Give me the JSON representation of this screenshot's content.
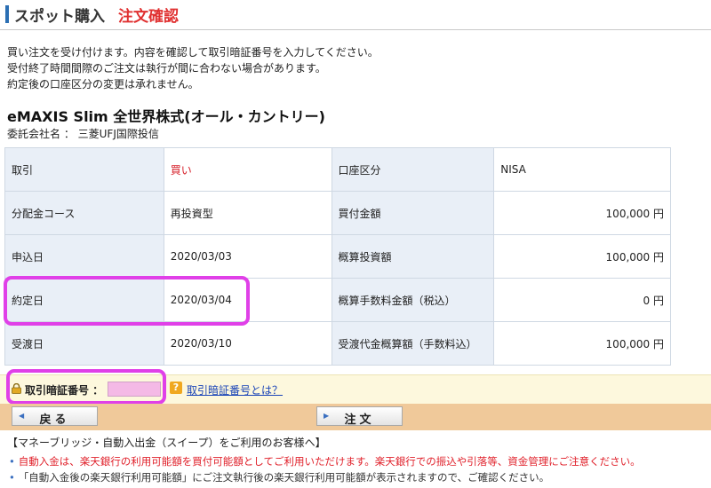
{
  "header": {
    "title": "スポット購入",
    "subtitle": "注文確認"
  },
  "intro": [
    "買い注文を受け付けます。内容を確認して取引暗証番号を入力してください。",
    "受付終了時間間際のご注文は執行が間に合わない場合があります。",
    "約定後の口座区分の変更は承れません。"
  ],
  "fund": {
    "name": "eMAXIS Slim 全世界株式(オール・カントリー)",
    "company_label": "委託会社名 ： 三菱UFJ国際投信"
  },
  "details": {
    "rows": [
      {
        "l1": "取引",
        "v1": "買い",
        "l2": "口座区分",
        "v2": "NISA"
      },
      {
        "l1": "分配金コース",
        "v1": "再投資型",
        "l2": "買付金額",
        "v2": "100,000 円"
      },
      {
        "l1": "申込日",
        "v1": "2020/03/03",
        "l2": "概算投資額",
        "v2": "100,000 円"
      },
      {
        "l1": "約定日",
        "v1": "2020/03/04",
        "l2": "概算手数料金額（税込）",
        "v2": "0 円"
      },
      {
        "l1": "受渡日",
        "v1": "2020/03/10",
        "l2": "受渡代金概算額（手数料込）",
        "v2": "100,000 円"
      }
    ]
  },
  "pin": {
    "label": "取引暗証番号 ：",
    "value": "",
    "help_icon": "question-icon",
    "help_link": "取引暗証番号とは？"
  },
  "buttons": {
    "back": "戻る",
    "order": "注文"
  },
  "sweep": {
    "title": "【マネーブリッジ・自動入出金（スイープ）をご利用のお客様へ】",
    "notes": [
      "自動入金は、楽天銀行の利用可能額を買付可能額としてご利用いただけます。楽天銀行での振込や引落等、資金管理にご注意ください。",
      "「自動入金後の楽天銀行利用可能額」にご注文執行後の楽天銀行利用可能額が表示されますので、ご確認ください。"
    ]
  },
  "colors": {
    "accent_red": "#d6202a",
    "highlight": "#e040e8",
    "label_bg": "#e9eff7",
    "pin_bg": "#fdf8dd",
    "button_bar": "#f0c99a"
  }
}
